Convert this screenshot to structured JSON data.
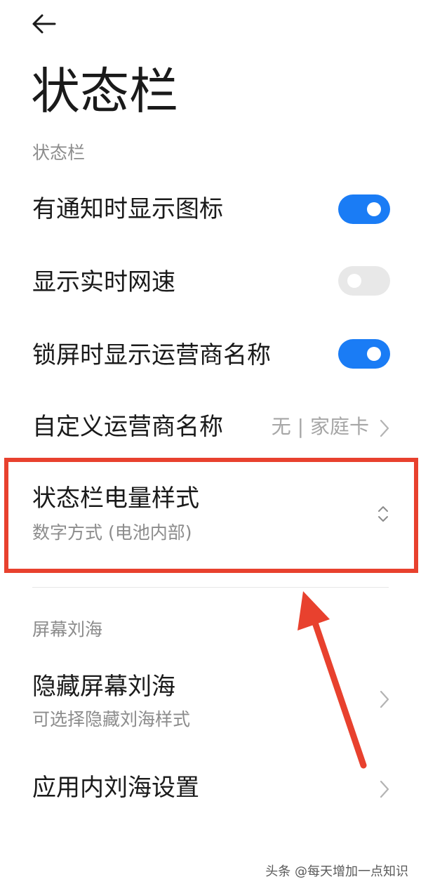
{
  "header": {
    "title": "状态栏"
  },
  "sections": {
    "status_bar": "状态栏",
    "notch": "屏幕刘海"
  },
  "rows": {
    "notify_icons": {
      "label": "有通知时显示图标",
      "toggle": "on"
    },
    "network_speed": {
      "label": "显示实时网速",
      "toggle": "off"
    },
    "lock_carrier": {
      "label": "锁屏时显示运营商名称",
      "toggle": "on"
    },
    "custom_carrier": {
      "label": "自定义运营商名称",
      "value": "无 | 家庭卡"
    },
    "battery_style": {
      "label": "状态栏电量样式",
      "sub": "数字方式 (电池内部)"
    },
    "hide_notch": {
      "label": "隐藏屏幕刘海",
      "sub": "可选择隐藏刘海样式"
    },
    "app_notch": {
      "label": "应用内刘海设置"
    }
  },
  "icons": {
    "back": "back-arrow-icon",
    "chevron_right": "chevron-right-icon",
    "chevron_updown": "chevron-updown-icon"
  },
  "colors": {
    "accent": "#1a7cf5",
    "highlight": "#e8412e",
    "secondary_text": "#8c8c8c"
  },
  "watermark": "头条 @每天增加一点知识"
}
